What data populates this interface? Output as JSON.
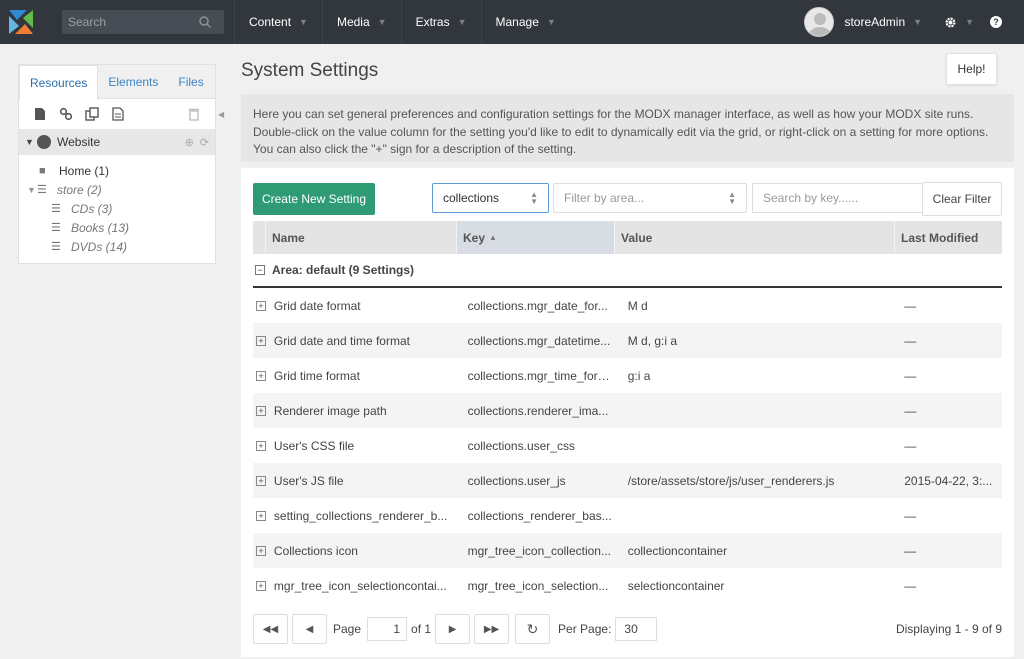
{
  "topbar": {
    "search_placeholder": "Search",
    "nav": [
      {
        "label": "Content"
      },
      {
        "label": "Media"
      },
      {
        "label": "Extras"
      },
      {
        "label": "Manage"
      }
    ],
    "username": "storeAdmin",
    "help_glyph": "?"
  },
  "leftpanel": {
    "tabs": [
      {
        "label": "Resources"
      },
      {
        "label": "Elements"
      },
      {
        "label": "Files"
      }
    ],
    "context_label": "Website",
    "tree": [
      {
        "label": "Home (1)"
      },
      {
        "label": "store (2)"
      },
      {
        "label": "CDs (3)"
      },
      {
        "label": "Books (13)"
      },
      {
        "label": "DVDs (14)"
      }
    ]
  },
  "page": {
    "title": "System Settings",
    "help_label": "Help!",
    "description": "Here you can set general preferences and configuration settings for the MODX manager interface, as well as how your MODX site runs. Double-click on the value column for the setting you'd like to edit to dynamically edit via the grid, or right-click on a setting for more options. You can also click the \"+\" sign for a description of the setting."
  },
  "toolbar": {
    "create_label": "Create New Setting",
    "namespace_value": "collections",
    "area_placeholder": "Filter by area...",
    "search_key_placeholder": "Search by key......",
    "clear_filter_label": "Clear Filter"
  },
  "grid": {
    "columns": [
      "Name",
      "Key",
      "Value",
      "Last Modified"
    ],
    "group_label": "Area: default (9 Settings)",
    "rows": [
      {
        "name": "Grid date format",
        "key": "collections.mgr_date_for...",
        "value": "M d",
        "modified": "—"
      },
      {
        "name": "Grid date and time format",
        "key": "collections.mgr_datetime...",
        "value": "M d, g:i a",
        "modified": "—"
      },
      {
        "name": "Grid time format",
        "key": "collections.mgr_time_format",
        "value": "g:i a",
        "modified": "—"
      },
      {
        "name": "Renderer image path",
        "key": "collections.renderer_ima...",
        "value": "",
        "modified": "—"
      },
      {
        "name": "User's CSS file",
        "key": "collections.user_css",
        "value": "",
        "modified": "—"
      },
      {
        "name": "User's JS file",
        "key": "collections.user_js",
        "value": "/store/assets/store/js/user_renderers.js",
        "modified": "2015-04-22, 3:..."
      },
      {
        "name": "setting_collections_renderer_b...",
        "key": "collections_renderer_bas...",
        "value": "",
        "modified": "—"
      },
      {
        "name": "Collections icon",
        "key": "mgr_tree_icon_collection...",
        "value": "collectioncontainer",
        "modified": "—"
      },
      {
        "name": "mgr_tree_icon_selectioncontai...",
        "key": "mgr_tree_icon_selection...",
        "value": "selectioncontainer",
        "modified": "—"
      }
    ]
  },
  "pager": {
    "page_label": "Page",
    "page_value": "1",
    "of_label": "of 1",
    "per_page_label": "Per Page:",
    "per_page_value": "30",
    "display_info": "Displaying 1 - 9 of 9"
  }
}
